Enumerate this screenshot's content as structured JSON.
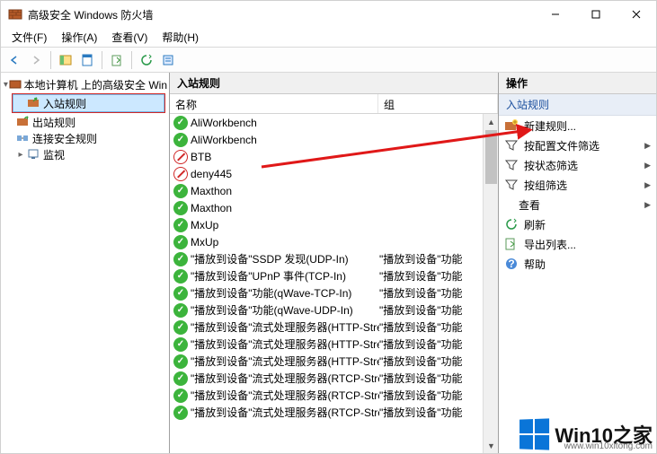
{
  "window": {
    "title": "高级安全 Windows 防火墙"
  },
  "menu": {
    "file": "文件(F)",
    "action": "操作(A)",
    "view": "查看(V)",
    "help": "帮助(H)"
  },
  "tree": {
    "root": "本地计算机 上的高级安全 Win",
    "inbound": "入站规则",
    "outbound": "出站规则",
    "conn": "连接安全规则",
    "monitor": "监视"
  },
  "rules_panel": {
    "title": "入站规则",
    "col_name": "名称",
    "col_group": "组"
  },
  "rules": [
    {
      "icon": "allow",
      "name": "AliWorkbench",
      "group": ""
    },
    {
      "icon": "allow",
      "name": "AliWorkbench",
      "group": ""
    },
    {
      "icon": "block",
      "name": "BTB",
      "group": ""
    },
    {
      "icon": "block",
      "name": "deny445",
      "group": ""
    },
    {
      "icon": "allow",
      "name": "Maxthon",
      "group": ""
    },
    {
      "icon": "allow",
      "name": "Maxthon",
      "group": ""
    },
    {
      "icon": "allow",
      "name": "MxUp",
      "group": ""
    },
    {
      "icon": "allow",
      "name": "MxUp",
      "group": ""
    },
    {
      "icon": "allow",
      "name": "\"播放到设备\"SSDP 发现(UDP-In)",
      "group": "\"播放到设备\"功能"
    },
    {
      "icon": "allow",
      "name": "\"播放到设备\"UPnP 事件(TCP-In)",
      "group": "\"播放到设备\"功能"
    },
    {
      "icon": "allow",
      "name": "\"播放到设备\"功能(qWave-TCP-In)",
      "group": "\"播放到设备\"功能"
    },
    {
      "icon": "allow",
      "name": "\"播放到设备\"功能(qWave-UDP-In)",
      "group": "\"播放到设备\"功能"
    },
    {
      "icon": "allow",
      "name": "\"播放到设备\"流式处理服务器(HTTP-Stre...",
      "group": "\"播放到设备\"功能"
    },
    {
      "icon": "allow",
      "name": "\"播放到设备\"流式处理服务器(HTTP-Stre...",
      "group": "\"播放到设备\"功能"
    },
    {
      "icon": "allow",
      "name": "\"播放到设备\"流式处理服务器(HTTP-Stre...",
      "group": "\"播放到设备\"功能"
    },
    {
      "icon": "allow",
      "name": "\"播放到设备\"流式处理服务器(RTCP-Stre...",
      "group": "\"播放到设备\"功能"
    },
    {
      "icon": "allow",
      "name": "\"播放到设备\"流式处理服务器(RTCP-Stre...",
      "group": "\"播放到设备\"功能"
    },
    {
      "icon": "allow",
      "name": "\"播放到设备\"流式处理服务器(RTCP-Stre...",
      "group": "\"播放到设备\"功能"
    }
  ],
  "actions": {
    "title": "操作",
    "subtitle": "入站规则",
    "new_rule": "新建规则...",
    "filter_profile": "按配置文件筛选",
    "filter_state": "按状态筛选",
    "filter_group": "按组筛选",
    "view": "查看",
    "refresh": "刷新",
    "export": "导出列表...",
    "help": "帮助"
  },
  "watermark": {
    "text": "Win10之家",
    "url": "www.win10xitong.com"
  }
}
